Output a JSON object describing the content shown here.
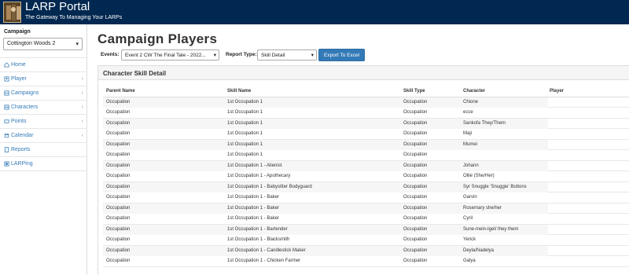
{
  "header": {
    "title": "LARP Portal",
    "subtitle": "The Gateway To Managing Your LARPs"
  },
  "sidebar": {
    "campaign_label": "Campaign",
    "campaign_value": "Cottington Woods 2",
    "items": [
      {
        "label": "Home",
        "icon": "home-icon",
        "has_chevron": false
      },
      {
        "label": "Player",
        "icon": "player-icon",
        "has_chevron": true
      },
      {
        "label": "Campaigns",
        "icon": "campaigns-icon",
        "has_chevron": true
      },
      {
        "label": "Characters",
        "icon": "characters-icon",
        "has_chevron": true
      },
      {
        "label": "Points",
        "icon": "points-icon",
        "has_chevron": true
      },
      {
        "label": "Calendar",
        "icon": "calendar-icon",
        "has_chevron": true
      },
      {
        "label": "Reports",
        "icon": "reports-icon",
        "has_chevron": false
      },
      {
        "label": "LARPing",
        "icon": "larping-icon",
        "has_chevron": false
      }
    ]
  },
  "main": {
    "title": "Campaign Players",
    "events_label": "Events:",
    "events_value": "Event 2 CW The Final Tale - 2022...",
    "report_type_label": "Report Type:",
    "report_type_value": "Skill Detail",
    "export_label": "Export To Excel",
    "panel_title": "Character Skill Detail",
    "columns": [
      "Parent Name",
      "Skill Name",
      "Skill Type",
      "Character",
      "Player"
    ],
    "rows": [
      [
        "Occupation",
        "1st Occupation 1",
        "Occupation",
        "Chione",
        ""
      ],
      [
        "Occupation",
        "1st Occupation 1",
        "Occupation",
        "ecce",
        ""
      ],
      [
        "Occupation",
        "1st Occupation 1",
        "Occupation",
        "Sankofa They/Them",
        ""
      ],
      [
        "Occupation",
        "1st Occupation 1",
        "Occupation",
        "Maji",
        ""
      ],
      [
        "Occupation",
        "1st Occupation 1",
        "Occupation",
        "Mumei",
        ""
      ],
      [
        "Occupation",
        "1st Occupation 1",
        "Occupation",
        "",
        ""
      ],
      [
        "Occupation",
        "1st Occupation 1 - Alienist",
        "Occupation",
        "Johann",
        ""
      ],
      [
        "Occupation",
        "1st Occupation 1 - Apothecary",
        "Occupation",
        "Ollie (She/Her)",
        ""
      ],
      [
        "Occupation",
        "1st Occupation 1 - Babysitter Bodyguard",
        "Occupation",
        "Syr Snuggle 'Snuggie' Buttons",
        ""
      ],
      [
        "Occupation",
        "1st Occupation 1 - Baker",
        "Occupation",
        "Garvin",
        ""
      ],
      [
        "Occupation",
        "1st Occupation 1 - Baker",
        "Occupation",
        "Rosemary she/her",
        ""
      ],
      [
        "Occupation",
        "1st Occupation 1 - Baker",
        "Occupation",
        "Cyril",
        ""
      ],
      [
        "Occupation",
        "1st Occupation 1 - Bartender",
        "Occupation",
        "Sune-mein-Igel/ they them",
        ""
      ],
      [
        "Occupation",
        "1st Occupation 1 - Blacksmith",
        "Occupation",
        "Yerick",
        ""
      ],
      [
        "Occupation",
        "1st Occupation 1 - Candlestick Maker",
        "Occupation",
        "Deyla/Nadelya",
        ""
      ],
      [
        "Occupation",
        "1st Occupation 1 - Chicken Farmer",
        "Occupation",
        "Galya",
        ""
      ]
    ]
  },
  "colors": {
    "topbar": "#002850",
    "link": "#337ab7",
    "button": "#337ab7"
  }
}
